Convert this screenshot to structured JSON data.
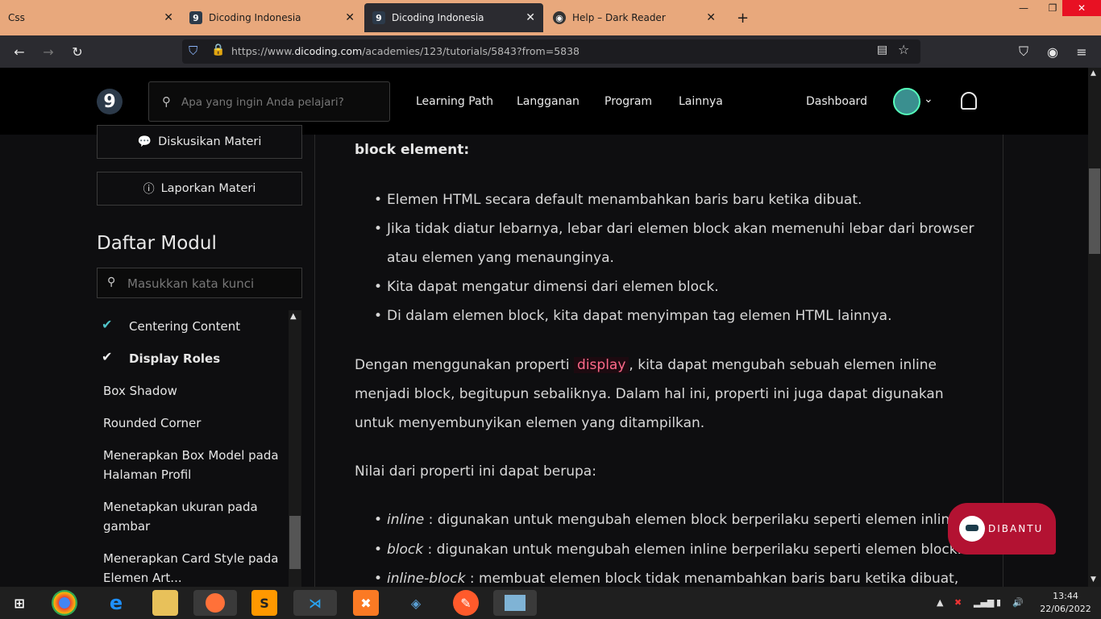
{
  "browser": {
    "tabs": [
      {
        "title": "Css"
      },
      {
        "title": "Dicoding Indonesia"
      },
      {
        "title": "Dicoding Indonesia"
      },
      {
        "title": "Help – Dark Reader"
      }
    ],
    "url_prefix": "https://www.",
    "url_domain": "dicoding.com",
    "url_path": "/academies/123/tutorials/5843?from=5838"
  },
  "header": {
    "logo": "9",
    "search_placeholder": "Apa yang ingin Anda pelajari?",
    "menu": [
      "Learning Path",
      "Langganan",
      "Program",
      "Lainnya"
    ],
    "dashboard": "Dashboard"
  },
  "sidebar": {
    "discuss_label": "Diskusikan Materi",
    "report_label": "Laporkan Materi",
    "module_title": "Daftar Modul",
    "keyword_placeholder": "Masukkan kata kunci",
    "modules": [
      {
        "label": "Centering Content",
        "done": true
      },
      {
        "label": "Display Roles",
        "done": true,
        "active": true
      },
      {
        "label": "Box Shadow",
        "done": false
      },
      {
        "label": "Rounded Corner",
        "done": false
      },
      {
        "label": "Menerapkan Box Model pada Halaman Profil",
        "done": false
      },
      {
        "label": "Menetapkan ukuran pada gambar",
        "done": false
      },
      {
        "label": "Menerapkan Card Style pada Elemen Art...",
        "done": false
      }
    ]
  },
  "content": {
    "heading": "block element:",
    "block_points": [
      "Elemen HTML secara default menambahkan baris baru ketika dibuat.",
      "Jika tidak diatur lebarnya, lebar dari elemen block akan memenuhi lebar dari browser atau elemen yang menaunginya.",
      "Kita dapat mengatur dimensi dari elemen block.",
      "Di dalam elemen block, kita dapat menyimpan tag elemen HTML lainnya."
    ],
    "para1_before": "Dengan menggunakan properti ",
    "para1_code": "display",
    "para1_after": ", kita dapat mengubah sebuah elemen inline menjadi block, begitupun sebaliknya. Dalam hal ini, properti ini juga dapat digunakan untuk menyembunyikan elemen yang ditampilkan.",
    "para2": "Nilai dari properti ini dapat berupa:",
    "values": [
      {
        "term": "inline",
        "desc": " : digunakan untuk mengubah elemen block berperilaku seperti elemen inline."
      },
      {
        "term": "block",
        "desc": " : digunakan untuk mengubah elemen inline berperilaku seperti elemen block."
      },
      {
        "term": "inline-block",
        "desc": " : membuat elemen block tidak menambahkan baris baru ketika dibuat,"
      }
    ]
  },
  "chat_widget": {
    "label": "DIBANTU"
  },
  "taskbar": {
    "time": "13:44",
    "date": "22/06/2022"
  }
}
